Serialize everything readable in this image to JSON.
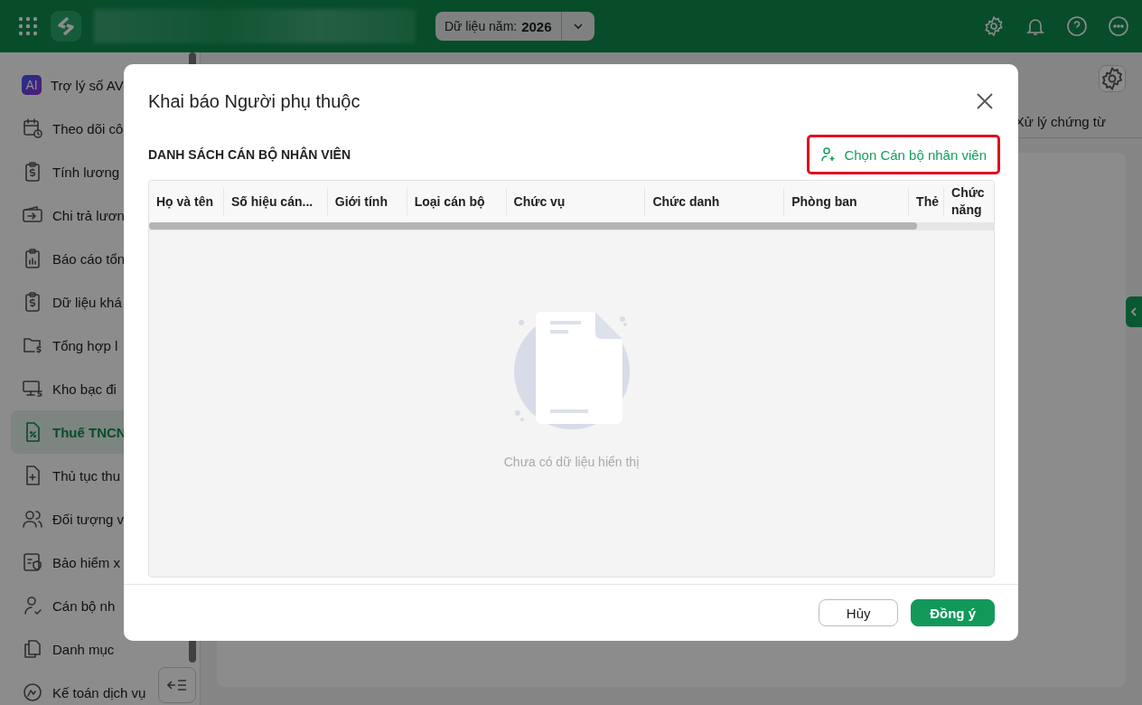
{
  "topbar": {
    "year_selector": {
      "label": "Dữ liệu năm:",
      "value": "2026"
    }
  },
  "sidebar": {
    "items": [
      {
        "label": "Trợ lý số AV",
        "badge": "AI",
        "selected": false
      },
      {
        "label": "Theo dõi cô",
        "selected": false
      },
      {
        "label": "Tính lương",
        "selected": false
      },
      {
        "label": "Chi trả lươn",
        "selected": false
      },
      {
        "label": "Báo cáo tổn",
        "selected": false
      },
      {
        "label": "Dữ liệu khá",
        "selected": false
      },
      {
        "label": "Tổng hợp l",
        "selected": false
      },
      {
        "label": "Kho bạc đi",
        "selected": false
      },
      {
        "label": "Thuế TNCN",
        "selected": true
      },
      {
        "label": "Thủ tục thu",
        "selected": false
      },
      {
        "label": "Đối tượng v",
        "selected": false
      },
      {
        "label": "Bảo hiểm x",
        "selected": false
      },
      {
        "label": "Cán bộ nh",
        "selected": false
      },
      {
        "label": "Danh mục",
        "selected": false
      },
      {
        "label": "Kế toán dịch vụ",
        "selected": false
      }
    ]
  },
  "main": {
    "tab": "Xử lý chứng từ"
  },
  "dialog": {
    "title": "Khai báo Người phụ thuộc",
    "section_title": "DANH SÁCH CÁN BỘ NHÂN VIÊN",
    "add_button": "Chọn Cán bộ nhân viên",
    "table": {
      "columns": [
        "Họ và tên",
        "Số hiệu cán...",
        "Giới tính",
        "Loại cán bộ",
        "Chức vụ",
        "Chức danh",
        "Phòng ban",
        "Thẻ",
        "Chức năng"
      ]
    },
    "empty_text": "Chưa có dữ liệu hiển thị",
    "buttons": [
      {
        "label": "Hủy",
        "kind": "secondary"
      },
      {
        "label": "Đồng ý",
        "kind": "primary"
      }
    ]
  }
}
